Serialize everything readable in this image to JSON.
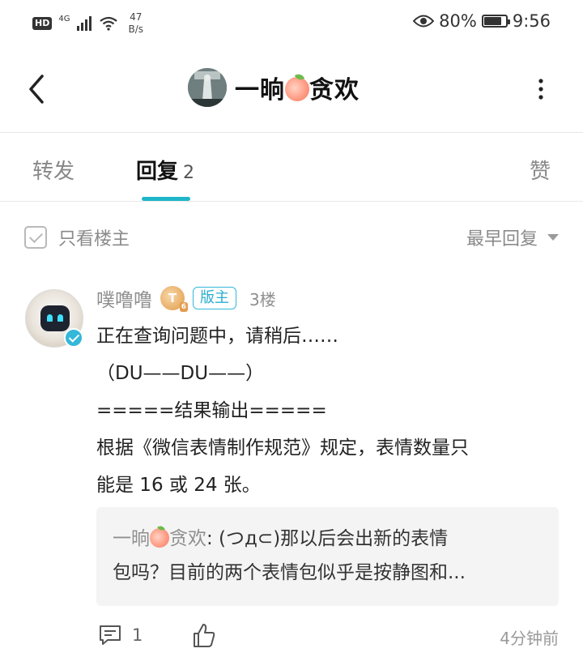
{
  "status_bar": {
    "hd_label": "HD",
    "network": "4G",
    "speed_value": "47",
    "speed_unit": "B/s",
    "battery": "80%",
    "battery_level": 0.8,
    "time": "9:56"
  },
  "header": {
    "title_prefix": "一晌",
    "title_suffix": "贪欢",
    "title_emoji_icon": "peach-icon",
    "back_icon": "back-arrow-icon",
    "more_icon": "more-vertical-icon"
  },
  "tabs": {
    "forward": "转发",
    "reply": "回复",
    "reply_count": "2",
    "like": "赞",
    "active": "回复",
    "accent_color": "#1fb6c9"
  },
  "filter": {
    "only_owner_label": "只看楼主",
    "sort_label": "最早回复"
  },
  "reply": {
    "username": "噗噜噜",
    "level_letter": "T",
    "level_sub": "6",
    "role_badge": "版主",
    "floor": "3楼",
    "lines": [
      "正在查询问题中，请稍后……",
      "（DU——DU——）",
      "=====结果输出=====",
      "根据《微信表情制作规范》规定，表情数量只",
      "能是 16 或 24 张。"
    ],
    "quote": {
      "name_prefix": "一晌",
      "name_suffix": "贪欢",
      "separator": ":",
      "line1": " (つд⊂)那以后会出新的表情",
      "line2": "包吗？目前的两个表情包似乎是按静图和..."
    },
    "comment_count": "1",
    "time": "4分钟前"
  }
}
